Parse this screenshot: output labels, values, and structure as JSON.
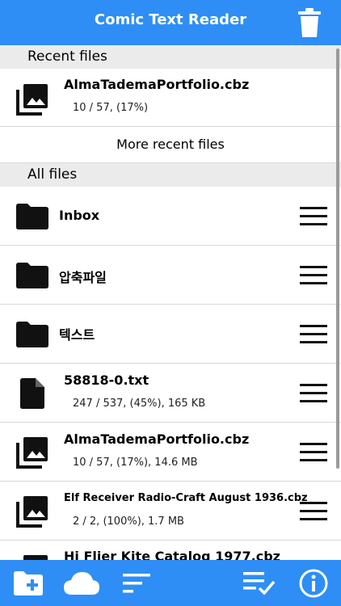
{
  "header": {
    "title": "Comic Text Reader",
    "trash_icon": "trash-icon"
  },
  "recent": {
    "header": "Recent files",
    "items": [
      {
        "name": "AlmaTademaPortfolio.cbz",
        "meta": "10 / 57, (17%)",
        "icon": "image-collection-icon"
      }
    ],
    "more_label": "More recent files"
  },
  "all": {
    "header": "All files",
    "items": [
      {
        "name": "Inbox",
        "meta": "",
        "icon": "folder-icon"
      },
      {
        "name": "압축파일",
        "meta": "",
        "icon": "folder-icon"
      },
      {
        "name": "텍스트",
        "meta": "",
        "icon": "folder-icon"
      },
      {
        "name": "58818-0.txt",
        "meta": "247 / 537, (45%), 165 KB",
        "icon": "document-icon"
      },
      {
        "name": "AlmaTademaPortfolio.cbz",
        "meta": "10 / 57, (17%), 14.6 MB",
        "icon": "image-collection-icon"
      },
      {
        "name": "Elf Receiver Radio-Craft August 1936.cbz",
        "meta": "2 / 2, (100%), 1.7 MB",
        "icon": "image-collection-icon"
      },
      {
        "name": "Hi Flier Kite Catalog 1977.cbz",
        "meta": "",
        "icon": "image-collection-icon"
      }
    ]
  },
  "bottom_bar": {
    "icons": [
      "add-folder-icon",
      "cloud-icon",
      "sort-icon",
      "select-list-icon",
      "info-icon"
    ]
  },
  "colors": {
    "accent": "#2e8ef5",
    "section_bg": "#ebebeb"
  }
}
